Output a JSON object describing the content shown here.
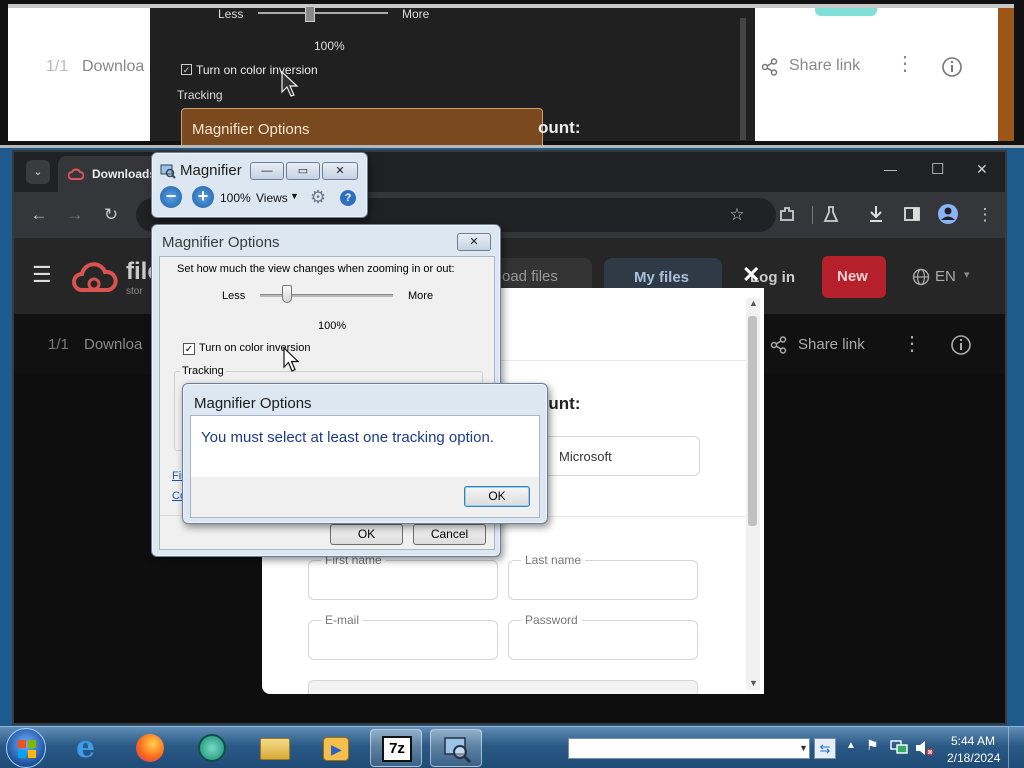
{
  "magnified": {
    "less": "Less",
    "more": "More",
    "percent": "100%",
    "inversion_label": "Turn on color inversion",
    "tracking": "Tracking",
    "dialog_title": "Magnifier Options",
    "page_counter": "1/1",
    "download": "Downloa",
    "share": "Share link",
    "account": "ount:"
  },
  "browser": {
    "tab_title": "Downloads",
    "window_controls": {
      "minimize": "—",
      "maximize": "☐",
      "close": "✕"
    },
    "site": {
      "brand": "file",
      "brand_sub": "stor",
      "nav": {
        "upload": "oad files",
        "my_files": "My files",
        "login": "Log in",
        "new": "New",
        "lang": "EN"
      },
      "sub": {
        "page_counter": "1/1",
        "download": "Downloa",
        "share": "Share link"
      }
    },
    "modal": {
      "heading": "ount:",
      "provider": "Microsoft",
      "fields": {
        "first_name": "First name",
        "last_name": "Last name",
        "email": "E-mail",
        "password": "Password"
      }
    }
  },
  "magnifier_toolbar": {
    "title": "Magnifier",
    "zoom": "100%",
    "views": "Views"
  },
  "options_dialog": {
    "title": "Magnifier Options",
    "instruction": "Set how much the view changes when zooming in or out:",
    "less": "Less",
    "more": "More",
    "zoom_value": "100%",
    "zoom_fraction": 0.2,
    "inversion_label": "Turn on color inversion",
    "inversion_checked": true,
    "tracking": "Tracking",
    "link1": "Fin",
    "link2": "Co",
    "ok": "OK",
    "cancel": "Cancel"
  },
  "alert": {
    "title": "Magnifier Options",
    "message": "You must select at least one tracking option.",
    "ok": "OK"
  },
  "taskbar": {
    "time": "5:44 AM",
    "date": "2/18/2024",
    "sevenzip": "7z",
    "apps": [
      "start-orb",
      "internet-explorer",
      "firefox",
      "chrome-like",
      "file-explorer",
      "media-player",
      "7-zip",
      "magnifier"
    ]
  },
  "colors": {
    "accent_red": "#c4232e",
    "dialog_text_blue": "#1a3a8c",
    "brand_red": "#d9534f"
  }
}
